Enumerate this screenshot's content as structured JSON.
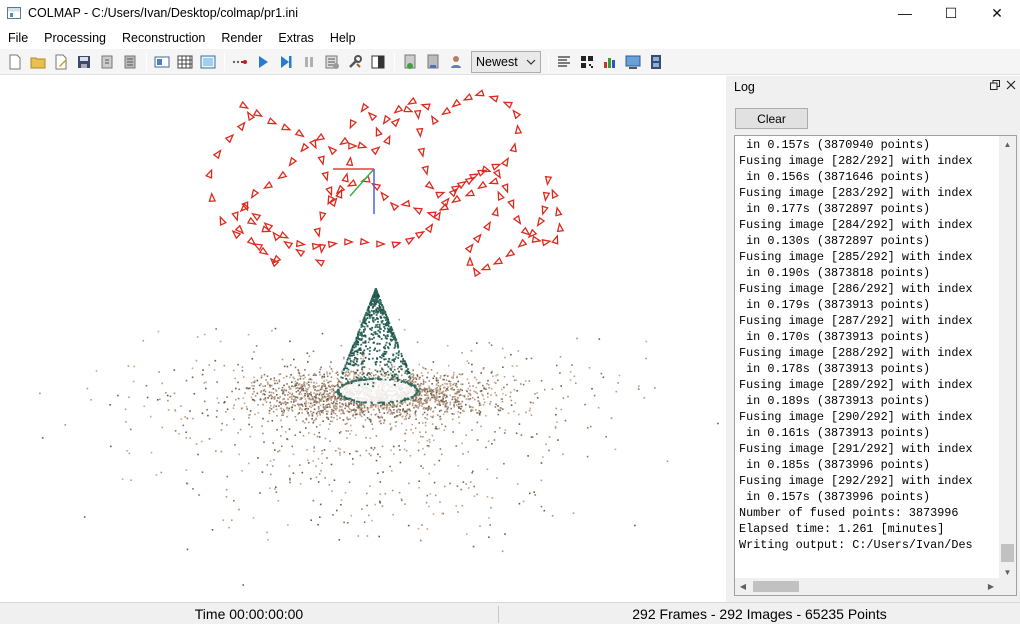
{
  "window": {
    "title": "COLMAP - C:/Users/Ivan/Desktop/colmap/pr1.ini",
    "minimize_glyph": "—",
    "maximize_glyph": "☐",
    "close_glyph": "✕"
  },
  "menu": {
    "items": [
      "File",
      "Processing",
      "Reconstruction",
      "Render",
      "Extras",
      "Help"
    ]
  },
  "toolbar": {
    "render_select": {
      "value": "Newest"
    }
  },
  "log": {
    "title": "Log",
    "clear_label": "Clear",
    "lines": [
      " in 0.157s (3870940 points)",
      "Fusing image [282/292] with index",
      " in 0.156s (3871646 points)",
      "Fusing image [283/292] with index",
      " in 0.177s (3872897 points)",
      "Fusing image [284/292] with index",
      " in 0.130s (3872897 points)",
      "Fusing image [285/292] with index",
      " in 0.190s (3873818 points)",
      "Fusing image [286/292] with index",
      " in 0.179s (3873913 points)",
      "Fusing image [287/292] with index",
      " in 0.170s (3873913 points)",
      "Fusing image [288/292] with index",
      " in 0.178s (3873913 points)",
      "Fusing image [289/292] with index",
      " in 0.189s (3873913 points)",
      "Fusing image [290/292] with index",
      " in 0.161s (3873913 points)",
      "Fusing image [291/292] with index",
      " in 0.185s (3873996 points)",
      "Fusing image [292/292] with index",
      " in 0.157s (3873996 points)",
      "Number of fused points: 3873996",
      "Elapsed time: 1.261 [minutes]",
      "Writing output: C:/Users/Ivan/Des"
    ]
  },
  "status": {
    "time": "Time 00:00:00:00",
    "summary": "292 Frames - 292 Images - 65235 Points"
  },
  "colors": {
    "camera": "#e0281c",
    "ground_points": "#a8907a",
    "cone_points": "#2f6b5e",
    "axis_x": "#e04040",
    "axis_y": "#40b040",
    "axis_z": "#5060e0"
  }
}
